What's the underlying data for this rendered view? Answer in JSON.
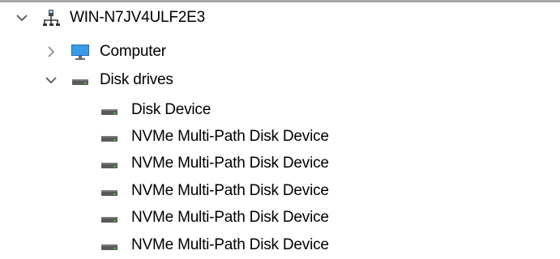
{
  "tree": {
    "root": {
      "label": "WIN-N7JV4ULF2E3",
      "icon": "computer-network-icon",
      "expanded": true
    },
    "computer": {
      "label": "Computer",
      "icon": "monitor-icon",
      "expanded": false
    },
    "disk_drives": {
      "label": "Disk drives",
      "icon": "disk-drive-icon",
      "expanded": true,
      "children": [
        {
          "label": "Disk Device",
          "icon": "disk-drive-icon"
        },
        {
          "label": "NVMe Multi-Path Disk Device",
          "icon": "disk-drive-icon"
        },
        {
          "label": "NVMe Multi-Path Disk Device",
          "icon": "disk-drive-icon"
        },
        {
          "label": "NVMe Multi-Path Disk Device",
          "icon": "disk-drive-icon"
        },
        {
          "label": "NVMe Multi-Path Disk Device",
          "icon": "disk-drive-icon"
        },
        {
          "label": "NVMe Multi-Path Disk Device",
          "icon": "disk-drive-icon"
        }
      ]
    }
  },
  "colors": {
    "chevron": "#555555",
    "monitor_screen": "#3a9be8",
    "monitor_frame": "#1f6fb5",
    "disk_body": "#5a5a5a",
    "disk_light": "#3ecf3e",
    "top_border": "#a9a9a9"
  }
}
